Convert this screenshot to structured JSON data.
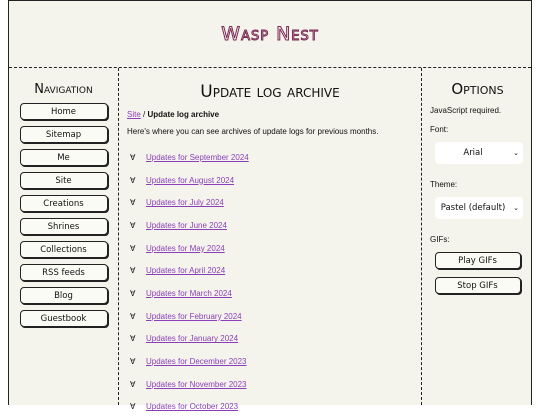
{
  "site": {
    "title": "Wasp Nest"
  },
  "navigation": {
    "heading": "Navigation",
    "items": [
      "Home",
      "Sitemap",
      "Me",
      "Site",
      "Creations",
      "Shrines",
      "Collections",
      "RSS feeds",
      "Blog",
      "Guestbook"
    ]
  },
  "main": {
    "heading": "Update log archive",
    "breadcrumb": {
      "link": "Site",
      "separator": "/",
      "current": "Update log archive"
    },
    "intro": "Here's where you can see archives of update logs for previous months.",
    "updates": [
      "Updates for September 2024",
      "Updates for August 2024",
      "Updates for July 2024",
      "Updates for June 2024",
      "Updates for May 2024",
      "Updates for April 2024",
      "Updates for March 2024",
      "Updates for February 2024",
      "Updates for January 2024",
      "Updates for December 2023",
      "Updates for November 2023",
      "Updates for October 2023"
    ]
  },
  "options": {
    "heading": "Options",
    "js_note": "JavaScript required.",
    "font_label": "Font:",
    "font_value": "Arial",
    "theme_label": "Theme:",
    "theme_value": "Pastel (default)",
    "gifs_label": "GIFs:",
    "play_gifs": "Play GIFs",
    "stop_gifs": "Stop GIFs"
  }
}
